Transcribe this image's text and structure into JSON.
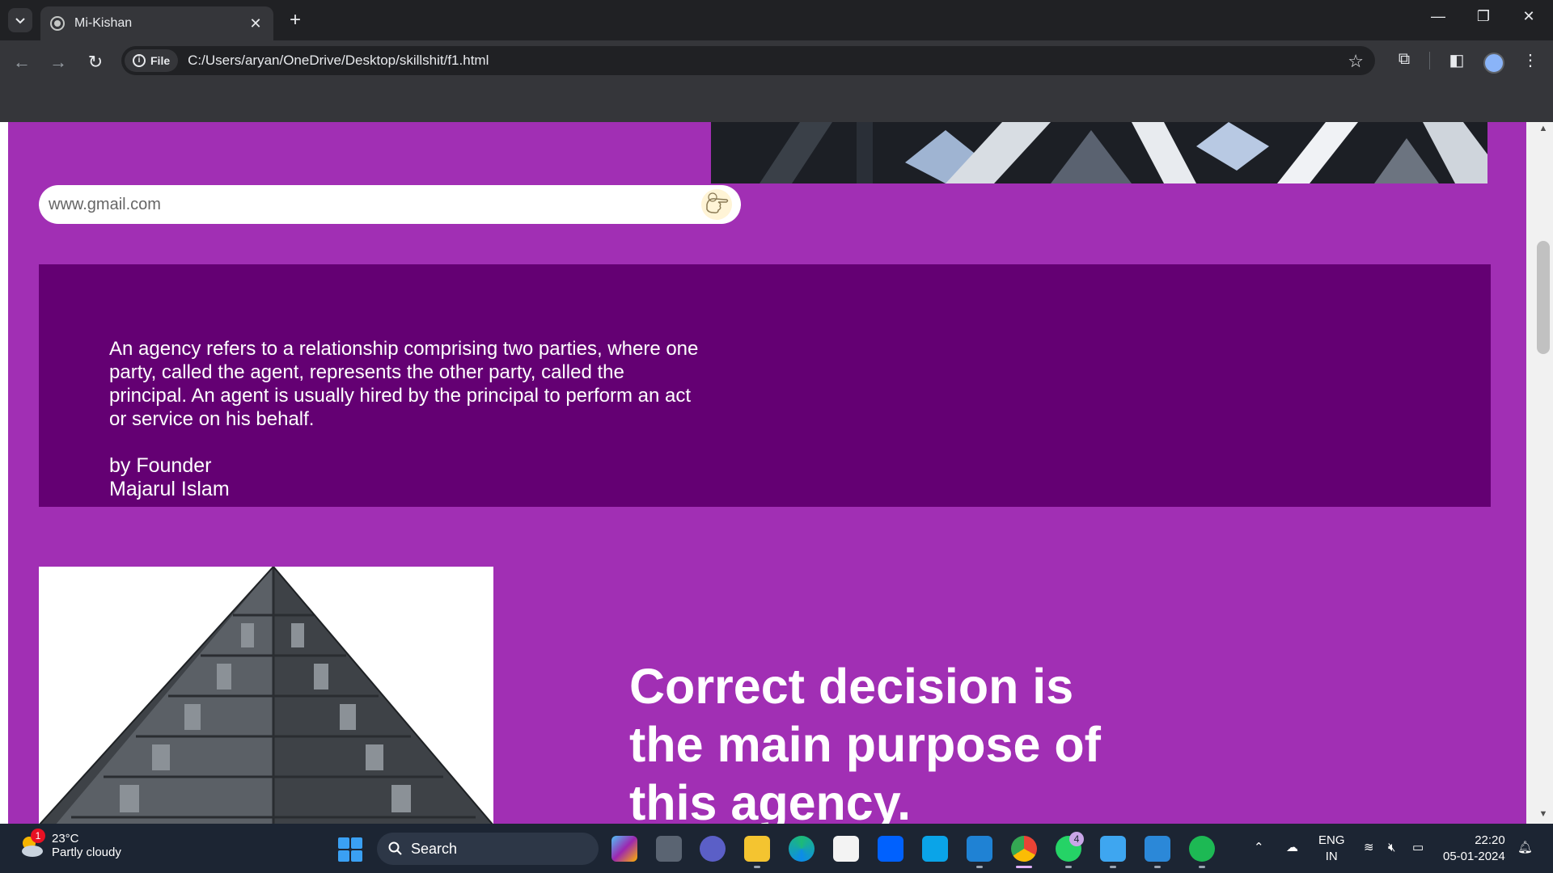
{
  "browser": {
    "tab_title": "Mi-Kishan",
    "site_chip": "File",
    "url": "C:/Users/aryan/OneDrive/Desktop/skillshit/f1.html"
  },
  "page": {
    "email_placeholder": "www.gmail.com",
    "quote": "An agency refers to a relationship comprising two parties, where one party, called the agent, represents the other party, called the principal. An agent is usually hired by the principal to perform an act or service on his behalf.",
    "quote_by_line1": "by Founder",
    "quote_by_line2": "Majarul Islam",
    "headline": "Correct decision is the main purpose of this agency.",
    "colors": {
      "page_bg": "#a12fb4",
      "quote_bg": "#640073"
    }
  },
  "taskbar": {
    "weather_temp": "23°C",
    "weather_condition": "Partly cloudy",
    "weather_badge": "1",
    "search_label": "Search",
    "whatsapp_badge": "4",
    "lang_line1": "ENG",
    "lang_line2": "IN",
    "time": "22:20",
    "date": "05-01-2024"
  }
}
